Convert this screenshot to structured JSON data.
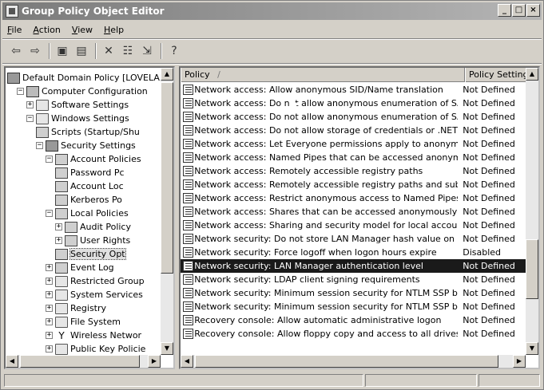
{
  "window": {
    "title": "Group Policy Object Editor",
    "controls": [
      "_",
      "□",
      "×"
    ]
  },
  "menu": [
    {
      "label": "File",
      "u": "F",
      "rest": "ile"
    },
    {
      "label": "Action",
      "u": "A",
      "rest": "ction"
    },
    {
      "label": "View",
      "u": "V",
      "rest": "iew"
    },
    {
      "label": "Help",
      "u": "H",
      "rest": "elp"
    }
  ],
  "toolbar": {
    "back_icon": "⇦",
    "forward_icon": "⇨",
    "up_icon": "▣",
    "show_tree_icon": "▤",
    "delete_icon": "✕",
    "properties_icon": "☷",
    "export_icon": "⇲",
    "help_icon": "?"
  },
  "tree": {
    "items": [
      {
        "label": "Default Domain Policy [LOVELAN",
        "icon": "policy",
        "expander": "",
        "indent": 0
      },
      {
        "label": "Computer Configuration",
        "icon": "computer",
        "expander": "−",
        "indent": 1
      },
      {
        "label": "Software Settings",
        "icon": "folder",
        "expander": "+",
        "indent": 2
      },
      {
        "label": "Windows Settings",
        "icon": "folder",
        "expander": "−",
        "indent": 2
      },
      {
        "label": "Scripts (Startup/Shu",
        "icon": "book",
        "expander": "",
        "indent": 3
      },
      {
        "label": "Security Settings",
        "icon": "policy",
        "expander": "−",
        "indent": 3
      },
      {
        "label": "Account Policies",
        "icon": "book",
        "expander": "−",
        "indent": 4
      },
      {
        "label": "Password Pc",
        "icon": "book",
        "expander": "",
        "indent": 5
      },
      {
        "label": "Account Loc",
        "icon": "book",
        "expander": "",
        "indent": 5
      },
      {
        "label": "Kerberos Po",
        "icon": "book",
        "expander": "",
        "indent": 5
      },
      {
        "label": "Local Policies",
        "icon": "book",
        "expander": "−",
        "indent": 4
      },
      {
        "label": "Audit Policy",
        "icon": "book",
        "expander": "+",
        "indent": 5
      },
      {
        "label": "User Rights",
        "icon": "book",
        "expander": "+",
        "indent": 5
      },
      {
        "label": "Security Opt",
        "icon": "book",
        "expander": "",
        "indent": 5,
        "selected": true
      },
      {
        "label": "Event Log",
        "icon": "book",
        "expander": "+",
        "indent": 4
      },
      {
        "label": "Restricted Group",
        "icon": "folder",
        "expander": "+",
        "indent": 4
      },
      {
        "label": "System Services",
        "icon": "folder",
        "expander": "+",
        "indent": 4
      },
      {
        "label": "Registry",
        "icon": "folder",
        "expander": "+",
        "indent": 4
      },
      {
        "label": "File System",
        "icon": "folder",
        "expander": "+",
        "indent": 4
      },
      {
        "label": "Wireless Networ",
        "icon": "wire",
        "expander": "+",
        "indent": 4
      },
      {
        "label": "Public Key Policie",
        "icon": "folder",
        "expander": "+",
        "indent": 4
      }
    ]
  },
  "list": {
    "columns": [
      "Policy",
      "Policy Setting"
    ],
    "sort_glyph": "/",
    "rows": [
      {
        "policy": "Network access: Allow anonymous SID/Name translation",
        "setting": "Not Defined"
      },
      {
        "policy": "Network access: Do not allow anonymous enumeration of SA...",
        "setting": "Not Defined"
      },
      {
        "policy": "Network access: Do not allow anonymous enumeration of SA...",
        "setting": "Not Defined"
      },
      {
        "policy": "Network access: Do not allow storage of credentials or .NET ...",
        "setting": "Not Defined"
      },
      {
        "policy": "Network access: Let Everyone permissions apply to anonymo...",
        "setting": "Not Defined"
      },
      {
        "policy": "Network access: Named Pipes that can be accessed anonymo...",
        "setting": "Not Defined"
      },
      {
        "policy": "Network access: Remotely accessible registry paths",
        "setting": "Not Defined"
      },
      {
        "policy": "Network access: Remotely accessible registry paths and sub-...",
        "setting": "Not Defined"
      },
      {
        "policy": "Network access: Restrict anonymous access to Named Pipes ...",
        "setting": "Not Defined"
      },
      {
        "policy": "Network access: Shares that can be accessed anonymously",
        "setting": "Not Defined"
      },
      {
        "policy": "Network access: Sharing and security model for local accounts",
        "setting": "Not Defined"
      },
      {
        "policy": "Network security: Do not store LAN Manager hash value on n...",
        "setting": "Not Defined"
      },
      {
        "policy": "Network security: Force logoff when logon hours expire",
        "setting": "Disabled"
      },
      {
        "policy": "Network security: LAN Manager authentication level",
        "setting": "Not Defined",
        "selected": true
      },
      {
        "policy": "Network security: LDAP client signing requirements",
        "setting": "Not Defined"
      },
      {
        "policy": "Network security: Minimum session security for NTLM SSP bas...",
        "setting": "Not Defined"
      },
      {
        "policy": "Network security: Minimum session security for NTLM SSP bas...",
        "setting": "Not Defined"
      },
      {
        "policy": "Recovery console: Allow automatic administrative logon",
        "setting": "Not Defined"
      },
      {
        "policy": "Recovery console: Allow floppy copy and access to all drives...",
        "setting": "Not Defined"
      }
    ]
  },
  "colors": {
    "face": "#d4d0c8",
    "selected_row": "#1a1a1a"
  }
}
